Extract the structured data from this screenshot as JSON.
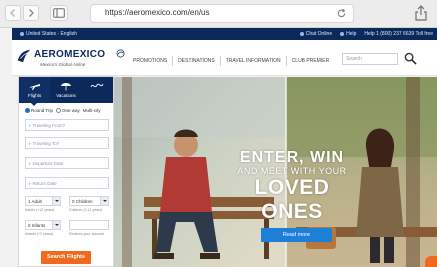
{
  "browser": {
    "url": "https://aeromexico.com/en/us",
    "icons": [
      "chevron-left-icon",
      "chevron-right-icon",
      "sidebar-icon",
      "reload-icon",
      "share-icon"
    ]
  },
  "topbar": {
    "location": "United States - English",
    "chat": "Chat Online",
    "help": "Help",
    "phone": "Help 1 (800) 237 6639",
    "tollfree": "Toll free"
  },
  "header": {
    "logo_name": "AEROMEXICO",
    "logo_tagline": "Mexico's Global Airline",
    "nav": [
      "PROMOTIONS",
      "DESTINATIONS",
      "TRAVEL INFORMATION",
      "CLUB PREMIER"
    ],
    "search_placeholder": "Search"
  },
  "booking": {
    "tabs": [
      "Flights",
      "Vacations",
      ""
    ],
    "trip_types": [
      "Round Trip",
      "One way",
      "Multi-city"
    ],
    "fields": [
      "Traveling From?",
      "Traveling To?",
      "Departure Date",
      "Return Date"
    ],
    "adults": "1 Adult",
    "adults_hint": "Adults (+12 years)",
    "children": "0 Children",
    "children_hint": "Children (2-11 years)",
    "infants": "0 Infants",
    "infants_hint": "Infants (+2 years)",
    "redeem": "Redeem your account",
    "search_button": "Search Flights"
  },
  "hero": {
    "line1": "ENTER, WIN",
    "line2": "AND MEET WITH YOUR",
    "line3": "LOVED ONES",
    "button": "Read more"
  },
  "colors": {
    "brand_navy": "#0b2a5b",
    "accent_orange": "#ef6a1f",
    "accent_blue": "#1d7fd6"
  }
}
